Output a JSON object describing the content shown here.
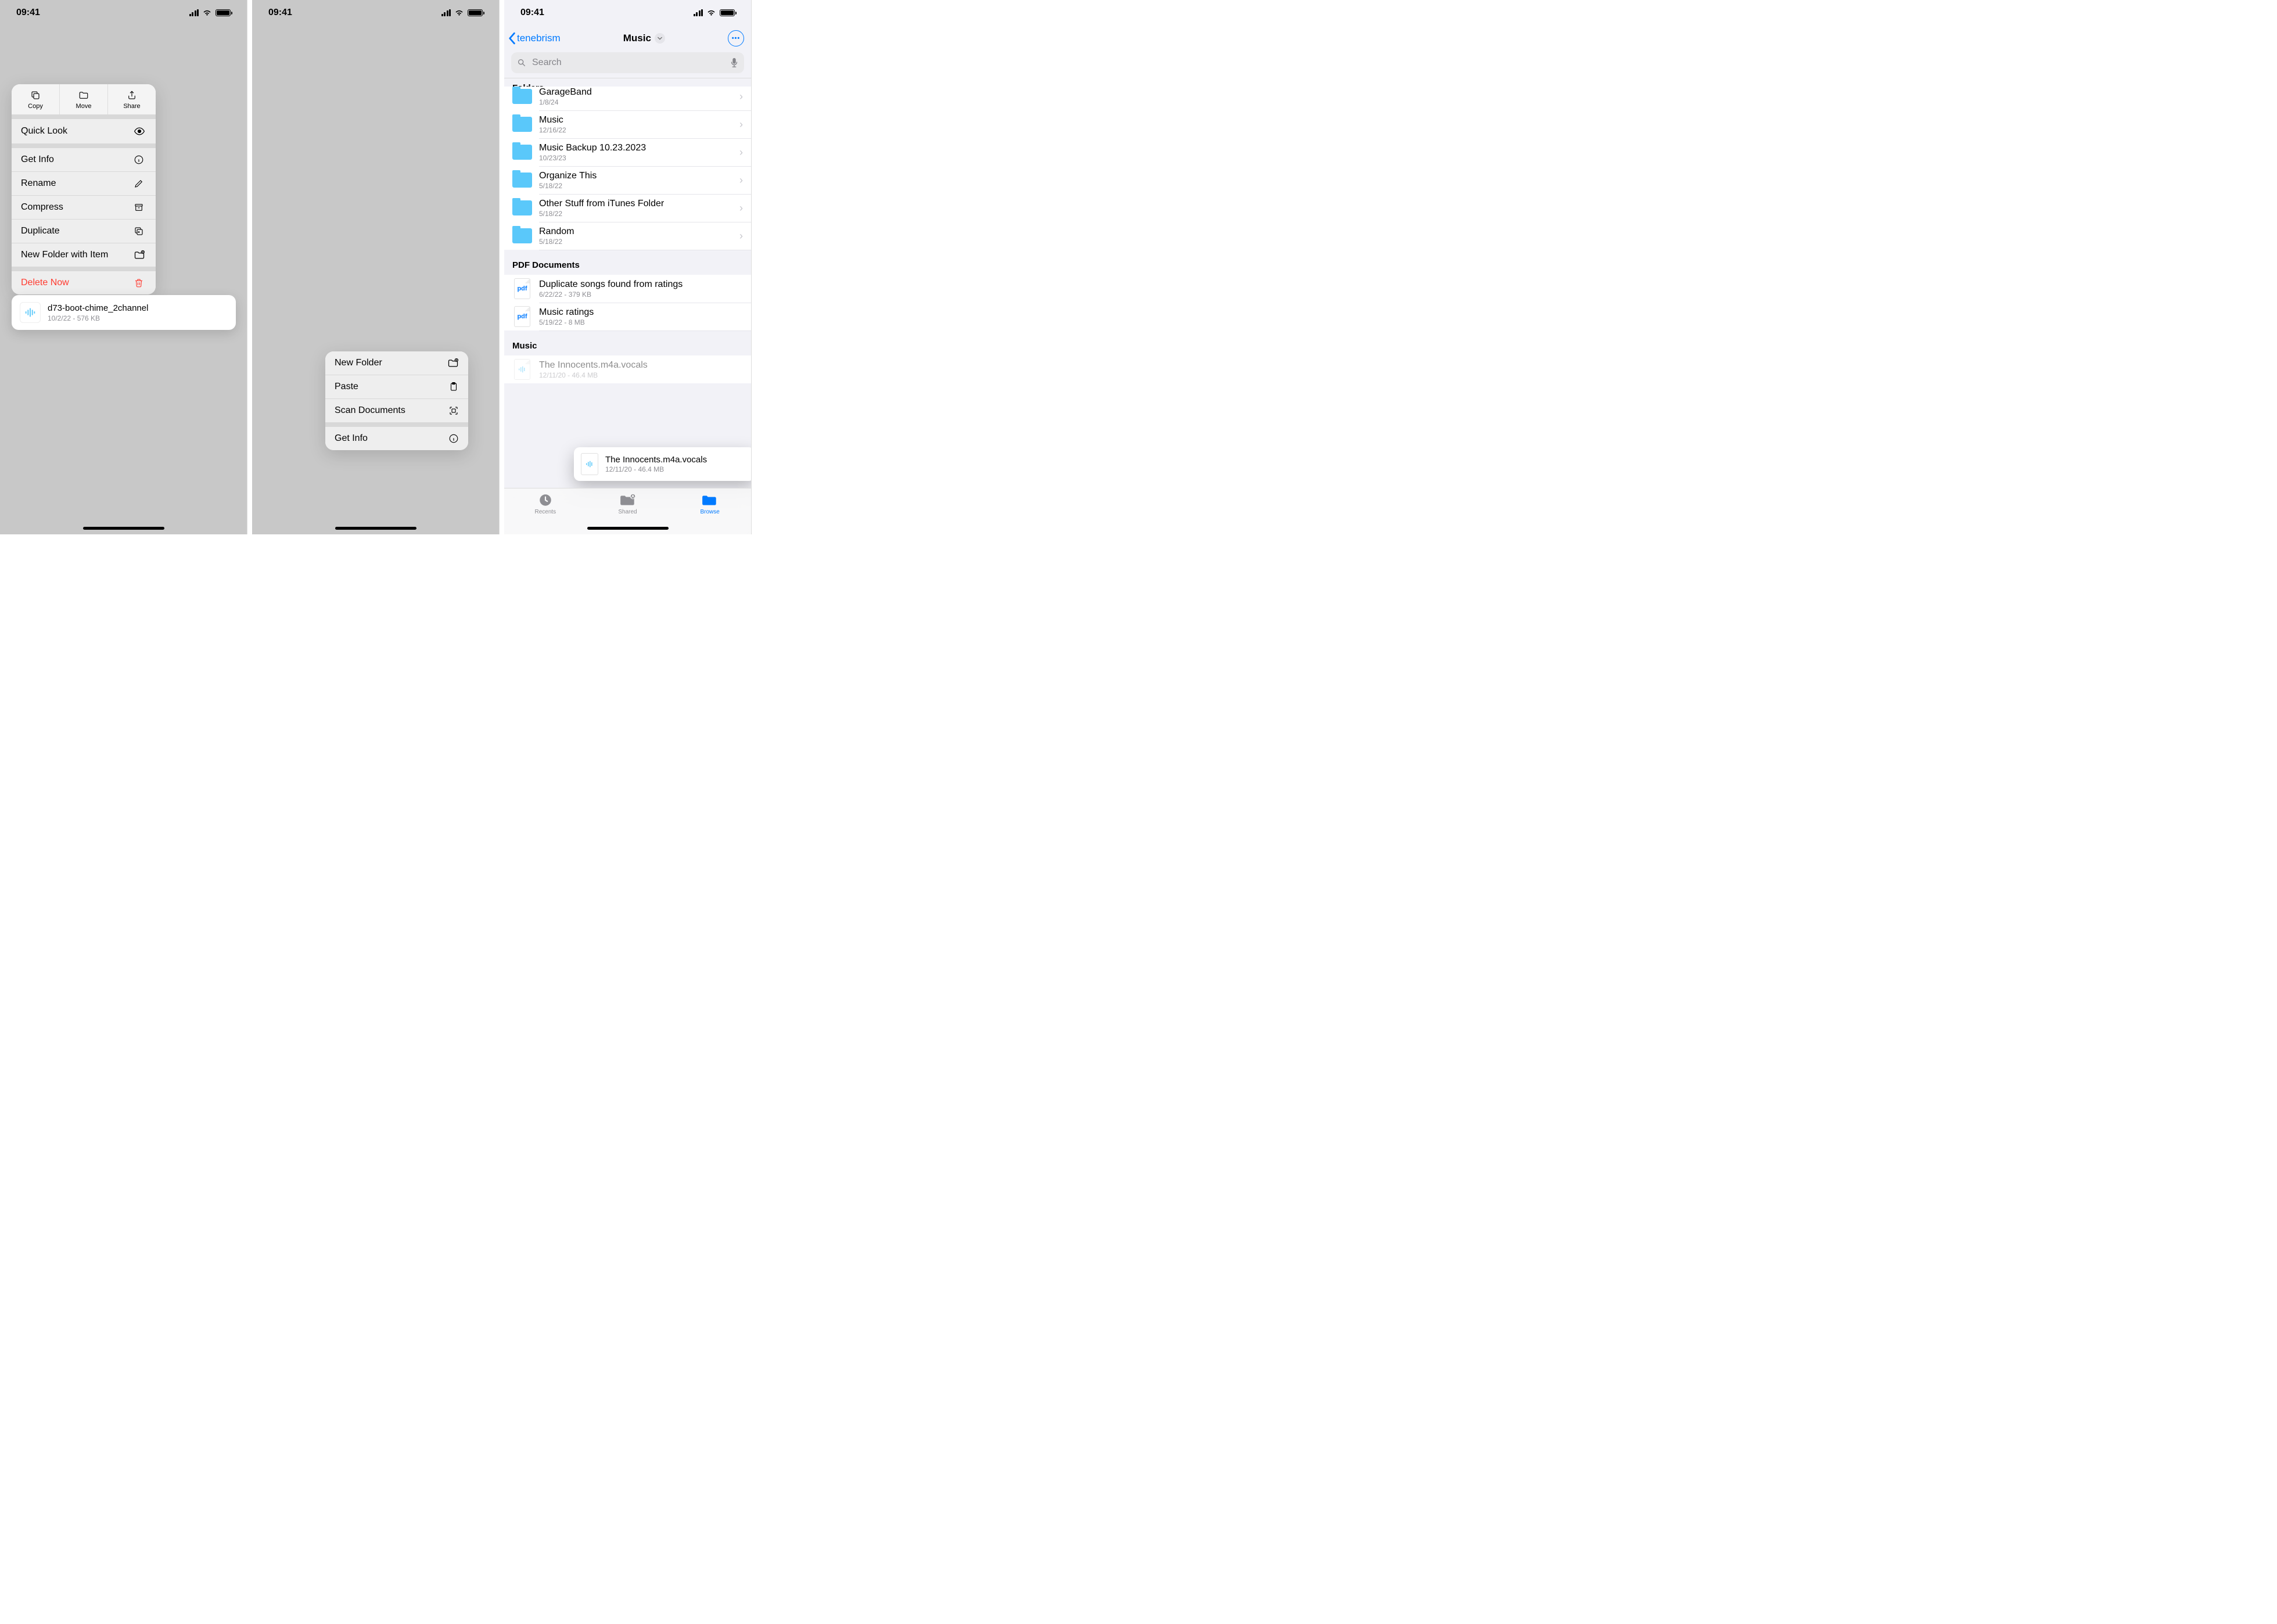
{
  "status": {
    "time": "09:41"
  },
  "panel1": {
    "toolbar": {
      "copy": "Copy",
      "move": "Move",
      "share": "Share"
    },
    "items": [
      {
        "label": "Quick Look",
        "icon": "eye"
      },
      {
        "label": "Get Info",
        "icon": "info"
      },
      {
        "label": "Rename",
        "icon": "pencil"
      },
      {
        "label": "Compress",
        "icon": "archive"
      },
      {
        "label": "Duplicate",
        "icon": "duplicate"
      },
      {
        "label": "New Folder with Item",
        "icon": "folder-plus"
      }
    ],
    "delete": "Delete Now",
    "file": {
      "name": "d73-boot-chime_2channel",
      "meta": "10/2/22 - 576 KB"
    }
  },
  "panel2": {
    "items": {
      "new_folder": "New Folder",
      "paste": "Paste",
      "scan": "Scan Documents",
      "get_info": "Get Info"
    }
  },
  "panel3": {
    "nav": {
      "back": "tenebrism",
      "title": "Music"
    },
    "search_placeholder": "Search",
    "sections": {
      "folders": "Folders",
      "pdf": "PDF Documents",
      "music": "Music"
    },
    "folders": [
      {
        "name": "GarageBand",
        "date": "1/8/24"
      },
      {
        "name": "Music",
        "date": "12/16/22"
      },
      {
        "name": "Music Backup 10.23.2023",
        "date": "10/23/23"
      },
      {
        "name": "Organize This",
        "date": "5/18/22"
      },
      {
        "name": "Other Stuff from iTunes Folder",
        "date": "5/18/22"
      },
      {
        "name": "Random",
        "date": "5/18/22"
      }
    ],
    "pdfs": [
      {
        "name": "Duplicate songs found from ratings",
        "meta": "6/22/22 - 379 KB"
      },
      {
        "name": "Music ratings",
        "meta": "5/19/22 - 8 MB"
      }
    ],
    "music_files": [
      {
        "name": "The Innocents.m4a.vocals",
        "meta": "12/11/20 - 46.4 MB"
      }
    ],
    "drag": {
      "name": "The Innocents.m4a.vocals",
      "meta": "12/11/20 - 46.4 MB"
    },
    "tabs": {
      "recents": "Recents",
      "shared": "Shared",
      "browse": "Browse"
    },
    "pdf_label": "pdf"
  }
}
